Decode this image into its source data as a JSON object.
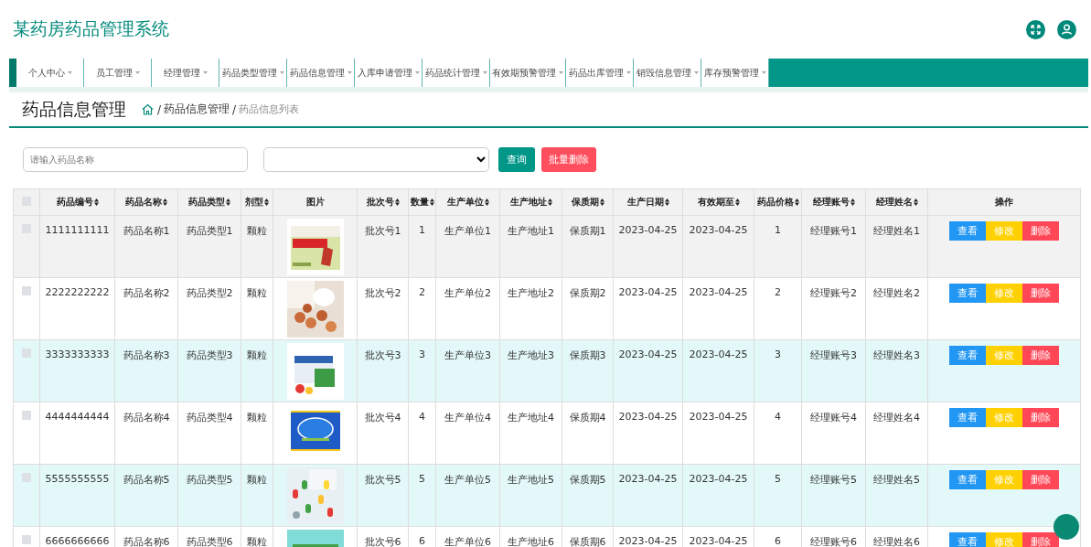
{
  "header": {
    "title": "某药房药品管理系统"
  },
  "nav": [
    {
      "label": "个人中心"
    },
    {
      "label": "员工管理"
    },
    {
      "label": "经理管理"
    },
    {
      "label": "药品类型管理"
    },
    {
      "label": "药品信息管理"
    },
    {
      "label": "入库申请管理"
    },
    {
      "label": "药品统计管理"
    },
    {
      "label": "有效期预警管理"
    },
    {
      "label": "药品出库管理"
    },
    {
      "label": "销毁信息管理"
    },
    {
      "label": "库存预警管理"
    }
  ],
  "page_title": "药品信息管理",
  "breadcrumb": [
    {
      "separator": "/",
      "label": "药品信息管理",
      "current": false
    },
    {
      "separator": "/",
      "label": "药品信息列表",
      "current": true
    }
  ],
  "search": {
    "placeholder": "请输入药品名称",
    "query_button": "查询",
    "batch_delete_button": "批量删除"
  },
  "table": {
    "select_all_checked": false,
    "columns": [
      {
        "label": "药品编号",
        "sortable": true,
        "kind": "text"
      },
      {
        "label": "药品名称",
        "sortable": true,
        "kind": "text"
      },
      {
        "label": "药品类型",
        "sortable": true,
        "kind": "text"
      },
      {
        "label": "剂型",
        "sortable": true,
        "kind": "text"
      },
      {
        "label": "图片",
        "sortable": false,
        "kind": "picture"
      },
      {
        "label": "批次号",
        "sortable": true,
        "kind": "text"
      },
      {
        "label": "数量",
        "sortable": true,
        "kind": "text"
      },
      {
        "label": "生产单位",
        "sortable": true,
        "kind": "text"
      },
      {
        "label": "生产地址",
        "sortable": true,
        "kind": "text"
      },
      {
        "label": "保质期",
        "sortable": true,
        "kind": "text"
      },
      {
        "label": "生产日期",
        "sortable": true,
        "kind": "text"
      },
      {
        "label": "有效期至",
        "sortable": true,
        "kind": "text"
      },
      {
        "label": "药品价格",
        "sortable": true,
        "kind": "text"
      },
      {
        "label": "经理账号",
        "sortable": true,
        "kind": "text"
      },
      {
        "label": "经理姓名",
        "sortable": true,
        "kind": "text"
      },
      {
        "label": "操作",
        "sortable": false,
        "kind": "actions"
      }
    ],
    "rows": [
      {
        "checked": false,
        "hovered": true,
        "cells": [
          "1111111111",
          "药品名称1",
          "药品类型1",
          "颗粒",
          "",
          "批次号1",
          "1",
          "生产单位1",
          "生产地址1",
          "保质期1",
          "2023-04-25",
          "2023-04-25",
          "1",
          "经理账号1",
          "经理姓名1"
        ],
        "actions": [
          "查看",
          "修改",
          "删除"
        ]
      },
      {
        "checked": false,
        "hovered": false,
        "cells": [
          "2222222222",
          "药品名称2",
          "药品类型2",
          "颗粒",
          "",
          "批次号2",
          "2",
          "生产单位2",
          "生产地址2",
          "保质期2",
          "2023-04-25",
          "2023-04-25",
          "2",
          "经理账号2",
          "经理姓名2"
        ],
        "actions": [
          "查看",
          "修改",
          "删除"
        ]
      },
      {
        "checked": false,
        "hovered": false,
        "cells": [
          "3333333333",
          "药品名称3",
          "药品类型3",
          "颗粒",
          "",
          "批次号3",
          "3",
          "生产单位3",
          "生产地址3",
          "保质期3",
          "2023-04-25",
          "2023-04-25",
          "3",
          "经理账号3",
          "经理姓名3"
        ],
        "actions": [
          "查看",
          "修改",
          "删除"
        ]
      },
      {
        "checked": false,
        "hovered": false,
        "cells": [
          "4444444444",
          "药品名称4",
          "药品类型4",
          "颗粒",
          "",
          "批次号4",
          "4",
          "生产单位4",
          "生产地址4",
          "保质期4",
          "2023-04-25",
          "2023-04-25",
          "4",
          "经理账号4",
          "经理姓名4"
        ],
        "actions": [
          "查看",
          "修改",
          "删除"
        ]
      },
      {
        "checked": false,
        "hovered": false,
        "cells": [
          "5555555555",
          "药品名称5",
          "药品类型5",
          "颗粒",
          "",
          "批次号5",
          "5",
          "生产单位5",
          "生产地址5",
          "保质期5",
          "2023-04-25",
          "2023-04-25",
          "5",
          "经理账号5",
          "经理姓名5"
        ],
        "actions": [
          "查看",
          "修改",
          "删除"
        ]
      },
      {
        "checked": false,
        "hovered": false,
        "cells": [
          "6666666666",
          "药品名称6",
          "药品类型6",
          "颗粒",
          "",
          "批次号6",
          "6",
          "生产单位6",
          "生产地址6",
          "保质期6",
          "2023-04-25",
          "2023-04-25",
          "6",
          "经理账号6",
          "经理姓名6"
        ],
        "actions": [
          "查看",
          "修改",
          "删除"
        ]
      }
    ]
  }
}
